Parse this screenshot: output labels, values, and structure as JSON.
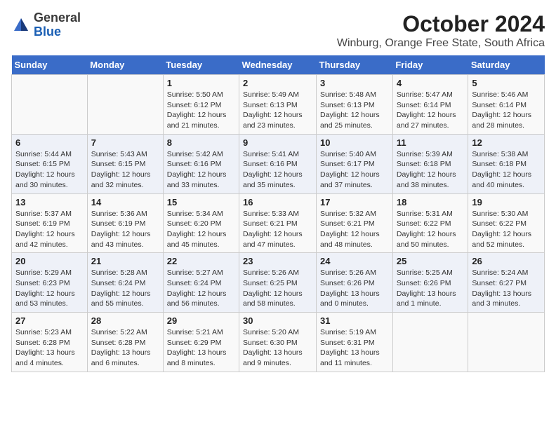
{
  "header": {
    "logo_general": "General",
    "logo_blue": "Blue",
    "month_title": "October 2024",
    "location": "Winburg, Orange Free State, South Africa"
  },
  "days_of_week": [
    "Sunday",
    "Monday",
    "Tuesday",
    "Wednesday",
    "Thursday",
    "Friday",
    "Saturday"
  ],
  "weeks": [
    [
      {
        "day": "",
        "content": ""
      },
      {
        "day": "",
        "content": ""
      },
      {
        "day": "1",
        "content": "Sunrise: 5:50 AM\nSunset: 6:12 PM\nDaylight: 12 hours and 21 minutes."
      },
      {
        "day": "2",
        "content": "Sunrise: 5:49 AM\nSunset: 6:13 PM\nDaylight: 12 hours and 23 minutes."
      },
      {
        "day": "3",
        "content": "Sunrise: 5:48 AM\nSunset: 6:13 PM\nDaylight: 12 hours and 25 minutes."
      },
      {
        "day": "4",
        "content": "Sunrise: 5:47 AM\nSunset: 6:14 PM\nDaylight: 12 hours and 27 minutes."
      },
      {
        "day": "5",
        "content": "Sunrise: 5:46 AM\nSunset: 6:14 PM\nDaylight: 12 hours and 28 minutes."
      }
    ],
    [
      {
        "day": "6",
        "content": "Sunrise: 5:44 AM\nSunset: 6:15 PM\nDaylight: 12 hours and 30 minutes."
      },
      {
        "day": "7",
        "content": "Sunrise: 5:43 AM\nSunset: 6:15 PM\nDaylight: 12 hours and 32 minutes."
      },
      {
        "day": "8",
        "content": "Sunrise: 5:42 AM\nSunset: 6:16 PM\nDaylight: 12 hours and 33 minutes."
      },
      {
        "day": "9",
        "content": "Sunrise: 5:41 AM\nSunset: 6:16 PM\nDaylight: 12 hours and 35 minutes."
      },
      {
        "day": "10",
        "content": "Sunrise: 5:40 AM\nSunset: 6:17 PM\nDaylight: 12 hours and 37 minutes."
      },
      {
        "day": "11",
        "content": "Sunrise: 5:39 AM\nSunset: 6:18 PM\nDaylight: 12 hours and 38 minutes."
      },
      {
        "day": "12",
        "content": "Sunrise: 5:38 AM\nSunset: 6:18 PM\nDaylight: 12 hours and 40 minutes."
      }
    ],
    [
      {
        "day": "13",
        "content": "Sunrise: 5:37 AM\nSunset: 6:19 PM\nDaylight: 12 hours and 42 minutes."
      },
      {
        "day": "14",
        "content": "Sunrise: 5:36 AM\nSunset: 6:19 PM\nDaylight: 12 hours and 43 minutes."
      },
      {
        "day": "15",
        "content": "Sunrise: 5:34 AM\nSunset: 6:20 PM\nDaylight: 12 hours and 45 minutes."
      },
      {
        "day": "16",
        "content": "Sunrise: 5:33 AM\nSunset: 6:21 PM\nDaylight: 12 hours and 47 minutes."
      },
      {
        "day": "17",
        "content": "Sunrise: 5:32 AM\nSunset: 6:21 PM\nDaylight: 12 hours and 48 minutes."
      },
      {
        "day": "18",
        "content": "Sunrise: 5:31 AM\nSunset: 6:22 PM\nDaylight: 12 hours and 50 minutes."
      },
      {
        "day": "19",
        "content": "Sunrise: 5:30 AM\nSunset: 6:22 PM\nDaylight: 12 hours and 52 minutes."
      }
    ],
    [
      {
        "day": "20",
        "content": "Sunrise: 5:29 AM\nSunset: 6:23 PM\nDaylight: 12 hours and 53 minutes."
      },
      {
        "day": "21",
        "content": "Sunrise: 5:28 AM\nSunset: 6:24 PM\nDaylight: 12 hours and 55 minutes."
      },
      {
        "day": "22",
        "content": "Sunrise: 5:27 AM\nSunset: 6:24 PM\nDaylight: 12 hours and 56 minutes."
      },
      {
        "day": "23",
        "content": "Sunrise: 5:26 AM\nSunset: 6:25 PM\nDaylight: 12 hours and 58 minutes."
      },
      {
        "day": "24",
        "content": "Sunrise: 5:26 AM\nSunset: 6:26 PM\nDaylight: 13 hours and 0 minutes."
      },
      {
        "day": "25",
        "content": "Sunrise: 5:25 AM\nSunset: 6:26 PM\nDaylight: 13 hours and 1 minute."
      },
      {
        "day": "26",
        "content": "Sunrise: 5:24 AM\nSunset: 6:27 PM\nDaylight: 13 hours and 3 minutes."
      }
    ],
    [
      {
        "day": "27",
        "content": "Sunrise: 5:23 AM\nSunset: 6:28 PM\nDaylight: 13 hours and 4 minutes."
      },
      {
        "day": "28",
        "content": "Sunrise: 5:22 AM\nSunset: 6:28 PM\nDaylight: 13 hours and 6 minutes."
      },
      {
        "day": "29",
        "content": "Sunrise: 5:21 AM\nSunset: 6:29 PM\nDaylight: 13 hours and 8 minutes."
      },
      {
        "day": "30",
        "content": "Sunrise: 5:20 AM\nSunset: 6:30 PM\nDaylight: 13 hours and 9 minutes."
      },
      {
        "day": "31",
        "content": "Sunrise: 5:19 AM\nSunset: 6:31 PM\nDaylight: 13 hours and 11 minutes."
      },
      {
        "day": "",
        "content": ""
      },
      {
        "day": "",
        "content": ""
      }
    ]
  ]
}
